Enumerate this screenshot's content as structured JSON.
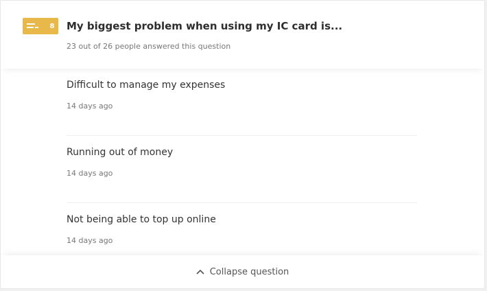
{
  "question": {
    "type_icon": "text-lines-icon",
    "number": "8",
    "badge_color": "#e8b84a",
    "title": "My biggest problem when using my IC card is...",
    "subtitle": "23 out of 26 people answered this question"
  },
  "answers": [
    {
      "text": "Difficult to manage my expenses",
      "time": "14 days ago"
    },
    {
      "text": "Running out of money",
      "time": "14 days ago"
    },
    {
      "text": "Not being able to top up online",
      "time": "14 days ago"
    }
  ],
  "footer": {
    "icon": "chevron-up-icon",
    "collapse_label": "Collapse question"
  }
}
